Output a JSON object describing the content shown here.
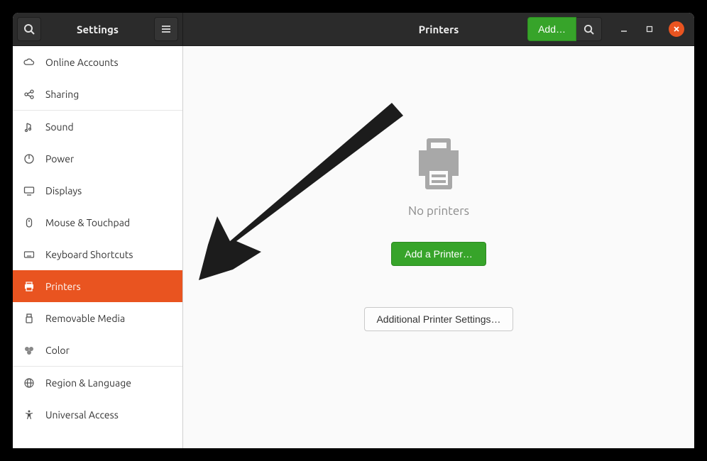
{
  "header": {
    "app_title": "Settings",
    "panel_title": "Printers",
    "add_button": "Add…"
  },
  "sidebar": {
    "items": [
      {
        "icon": "cloud",
        "label": "Online Accounts"
      },
      {
        "icon": "share",
        "label": "Sharing"
      },
      {
        "icon": "sound",
        "label": "Sound"
      },
      {
        "icon": "power",
        "label": "Power"
      },
      {
        "icon": "display",
        "label": "Displays"
      },
      {
        "icon": "mouse",
        "label": "Mouse & Touchpad"
      },
      {
        "icon": "keyboard",
        "label": "Keyboard Shortcuts"
      },
      {
        "icon": "printer",
        "label": "Printers"
      },
      {
        "icon": "usb",
        "label": "Removable Media"
      },
      {
        "icon": "color",
        "label": "Color"
      },
      {
        "icon": "globe",
        "label": "Region & Language"
      },
      {
        "icon": "accessibility",
        "label": "Universal Access"
      }
    ],
    "selected_index": 7,
    "separators_after_index": [
      1,
      9
    ]
  },
  "content": {
    "empty_text": "No printers",
    "add_printer_button": "Add a Printer…",
    "additional_settings_button": "Additional Printer Settings…"
  },
  "colors": {
    "accent": "#e95420",
    "green": "#37a42a"
  }
}
